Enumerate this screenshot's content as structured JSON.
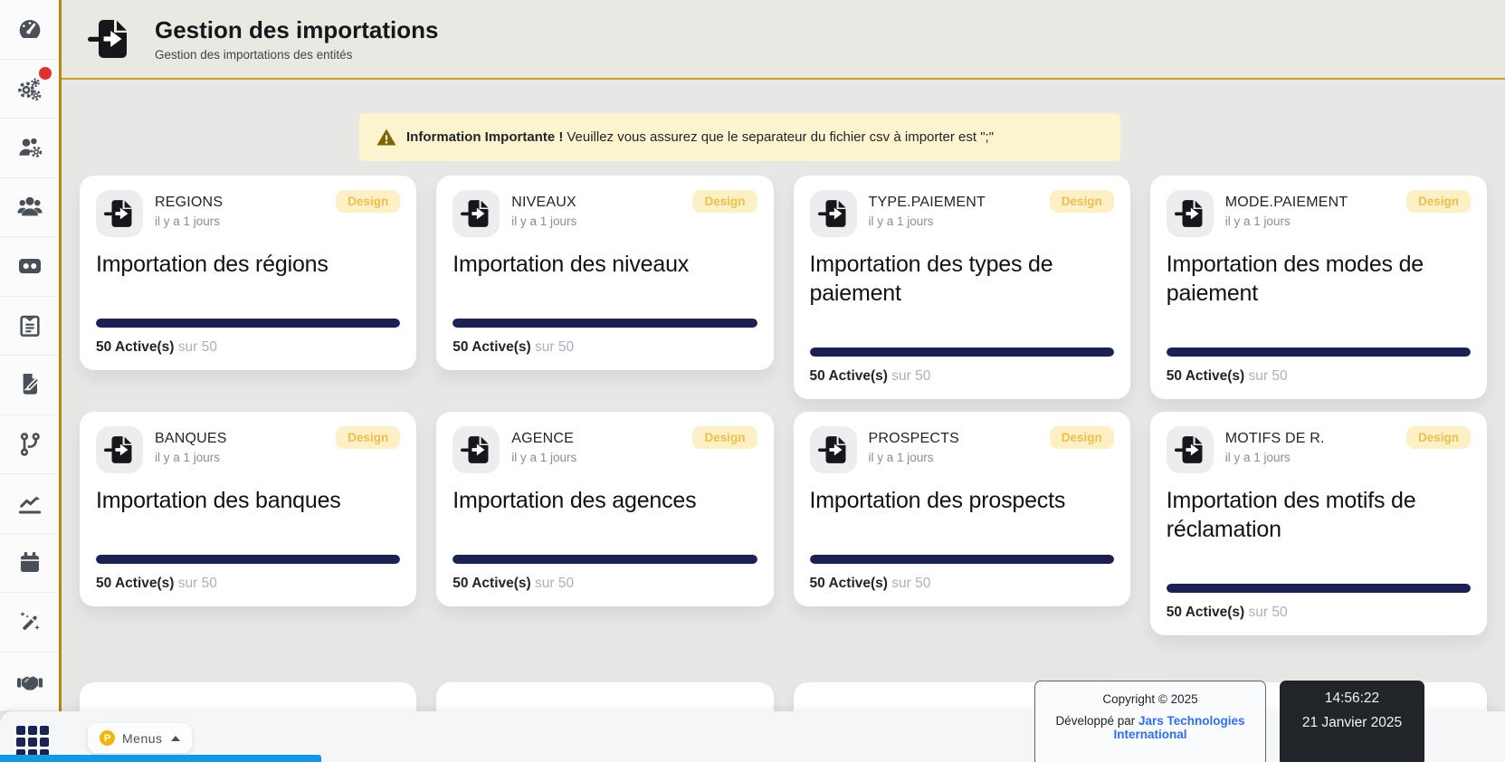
{
  "header": {
    "title": "Gestion des importations",
    "subtitle": "Gestion des importations des entités"
  },
  "alert": {
    "title": "Information Importante !",
    "message": "Veuillez vous assurez que le separateur du fichier csv à importer est \";\""
  },
  "cards": [
    {
      "name": "REGIONS",
      "time": "il y a 1 jours",
      "badge": "Design",
      "heading": "Importation des régions",
      "active": "50 Active(s)",
      "total": "sur 50",
      "progress_percent": 100
    },
    {
      "name": "NIVEAUX",
      "time": "il y a 1 jours",
      "badge": "Design",
      "heading": "Importation des niveaux",
      "active": "50 Active(s)",
      "total": "sur 50",
      "progress_percent": 100
    },
    {
      "name": "TYPE.PAIEMENT",
      "time": "il y a 1 jours",
      "badge": "Design",
      "heading": "Importation des types de paiement",
      "active": "50 Active(s)",
      "total": "sur 50",
      "progress_percent": 100
    },
    {
      "name": "MODE.PAIEMENT",
      "time": "il y a 1 jours",
      "badge": "Design",
      "heading": "Importation des modes de paiement",
      "active": "50 Active(s)",
      "total": "sur 50",
      "progress_percent": 100
    },
    {
      "name": "BANQUES",
      "time": "il y a 1 jours",
      "badge": "Design",
      "heading": "Importation des banques",
      "active": "50 Active(s)",
      "total": "sur 50",
      "progress_percent": 100
    },
    {
      "name": "AGENCE",
      "time": "il y a 1 jours",
      "badge": "Design",
      "heading": "Importation des agences",
      "active": "50 Active(s)",
      "total": "sur 50",
      "progress_percent": 100
    },
    {
      "name": "PROSPECTS",
      "time": "il y a 1 jours",
      "badge": "Design",
      "heading": "Importation des prospects",
      "active": "50 Active(s)",
      "total": "sur 50",
      "progress_percent": 100
    },
    {
      "name": "MOTIFS DE R.",
      "time": "il y a 1 jours",
      "badge": "Design",
      "heading": "Importation des motifs de réclamation",
      "active": "50 Active(s)",
      "total": "sur 50",
      "progress_percent": 100
    }
  ],
  "sidebar": {
    "icons": [
      "dashboard",
      "settings-gears",
      "user-management",
      "users-group",
      "archive-cassette",
      "form-clipboard",
      "file-signature",
      "git-branch",
      "chart-line",
      "calendar",
      "magic-wand",
      "handshake"
    ],
    "notification_on": "settings-gears"
  },
  "footer": {
    "menus_label": "Menus",
    "menus_badge": "P",
    "copyright": "Copyright © 2025",
    "developed_by": "Développé par",
    "developer_link": "Jars Technologies International",
    "clock_time": "14:56:22",
    "clock_date": "21 Janvier 2025"
  },
  "colors": {
    "accent_gold": "#b8860b",
    "header_underline": "#c9a227",
    "progress_navy": "#1b2150",
    "badge_bg": "#fdf0c5",
    "badge_text": "#ecbf4e",
    "alert_bg": "#fcf3cf",
    "blue_bar": "#1499e0",
    "link_blue": "#2f6fed",
    "clock_bg": "#212529",
    "notification_red": "#e03131"
  }
}
